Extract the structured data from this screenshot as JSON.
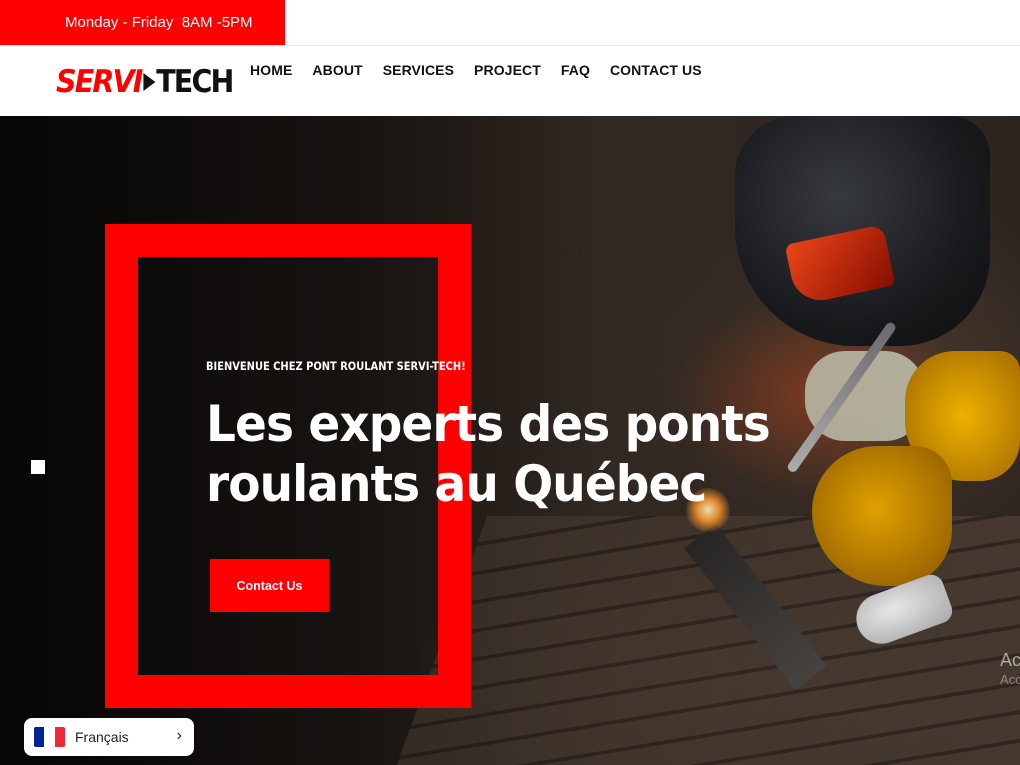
{
  "topbar": {
    "hours": "Monday - Friday  8AM -5PM"
  },
  "header": {
    "logo": {
      "part1": "SERVI",
      "part2": "TECH"
    },
    "nav": [
      {
        "label": "HOME"
      },
      {
        "label": "ABOUT"
      },
      {
        "label": "SERVICES"
      },
      {
        "label": "PROJECT"
      },
      {
        "label": "FAQ"
      },
      {
        "label": "CONTACT US"
      }
    ]
  },
  "hero": {
    "kicker": "BIENVENUE CHEZ PONT ROULANT SERVI-TECH!",
    "title_line1": "Les experts des ponts",
    "title_line2": "roulants au Québec",
    "cta_label": "Contact Us",
    "watermark_line1": "Ac",
    "watermark_line2": "Acc"
  },
  "language_switcher": {
    "label": "Français",
    "flag_colors": [
      "#002395",
      "#ffffff",
      "#ed2939"
    ]
  },
  "colors": {
    "accent": "#ff0000",
    "text_dark": "#111111"
  }
}
